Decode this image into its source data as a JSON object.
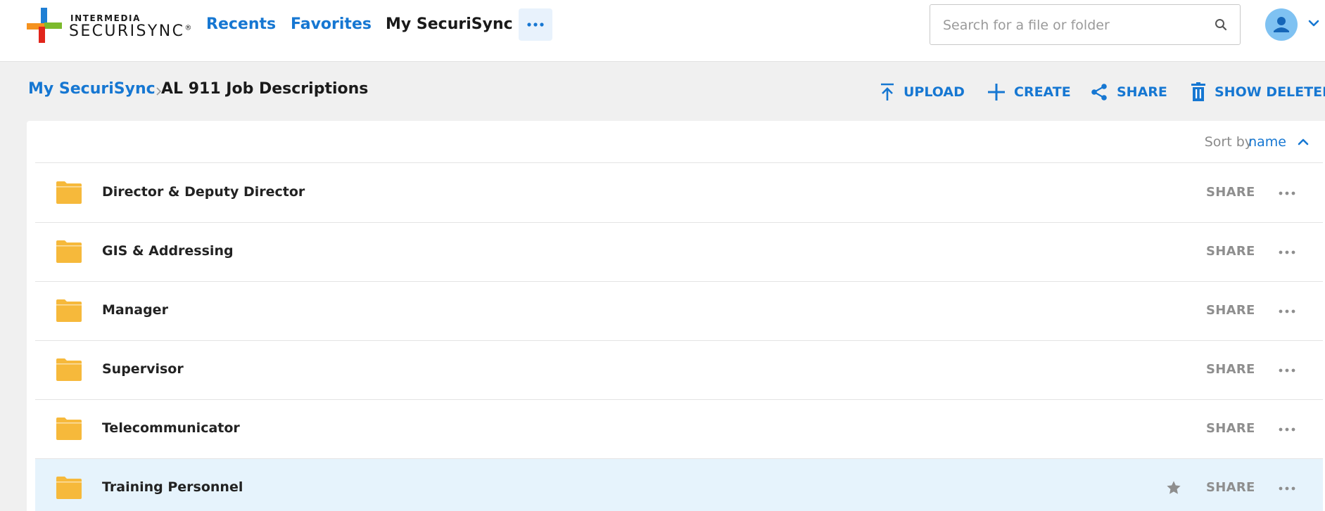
{
  "brand": {
    "line1": "INTERMEDIA",
    "line2": "SECURISYNC",
    "registered": "®",
    "colors": {
      "blue": "#1f7fd4",
      "green": "#7cba2c",
      "orange": "#f5921e",
      "red": "#e1251b"
    }
  },
  "nav": {
    "recents": "Recents",
    "favorites": "Favorites",
    "my_securisync": "My SecuriSync",
    "more_icon": "ellipsis-icon"
  },
  "search": {
    "placeholder": "Search for a file or folder",
    "value": ""
  },
  "breadcrumb": {
    "home": "My SecuriSync",
    "current": "AL 911 Job Descriptions"
  },
  "actions": {
    "upload": "UPLOAD",
    "create": "CREATE",
    "share": "SHARE",
    "show_deleted": "SHOW DELETED"
  },
  "sort": {
    "label": "Sort by",
    "value": "name",
    "direction": "ascending"
  },
  "files": [
    {
      "name": "Director & Deputy Director",
      "share": "SHARE",
      "selected": false
    },
    {
      "name": "GIS & Addressing",
      "share": "SHARE",
      "selected": false
    },
    {
      "name": "Manager",
      "share": "SHARE",
      "selected": false
    },
    {
      "name": "Supervisor",
      "share": "SHARE",
      "selected": false
    },
    {
      "name": "Telecommunicator",
      "share": "SHARE",
      "selected": false
    },
    {
      "name": "Training Personnel",
      "share": "SHARE",
      "selected": true
    }
  ],
  "colors": {
    "accent": "#1677d2",
    "folder": "#f6b93b",
    "selected_row": "#e6f3fc",
    "background": "#f0f0f0"
  }
}
